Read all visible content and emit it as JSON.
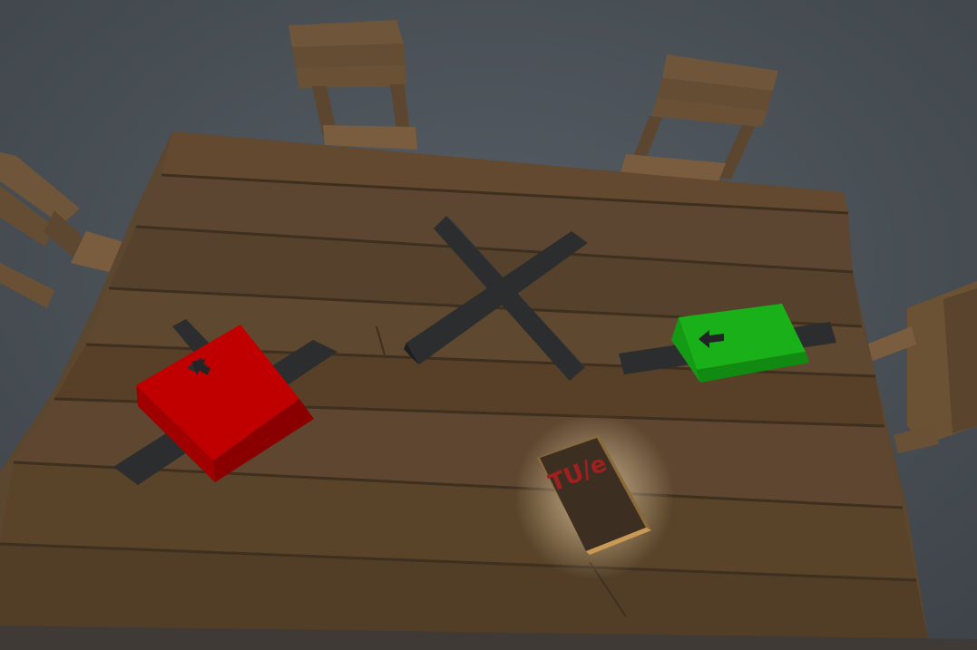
{
  "scene": {
    "background_color": "#4d545a",
    "table_color": "#5b4630",
    "chair_color": "#6b5234"
  },
  "book": {
    "title": "TU/e",
    "title_color": "#a01f1f",
    "cover_color": "#3d2e22"
  },
  "pieces": [
    {
      "name": "red-block",
      "color": "#c00000",
      "arrow_icon": "arrow-left-icon"
    },
    {
      "name": "green-block",
      "color": "#19b019",
      "arrow_icon": "arrow-left-icon"
    },
    {
      "name": "cross-marker",
      "color": "#2b2d2e"
    }
  ]
}
